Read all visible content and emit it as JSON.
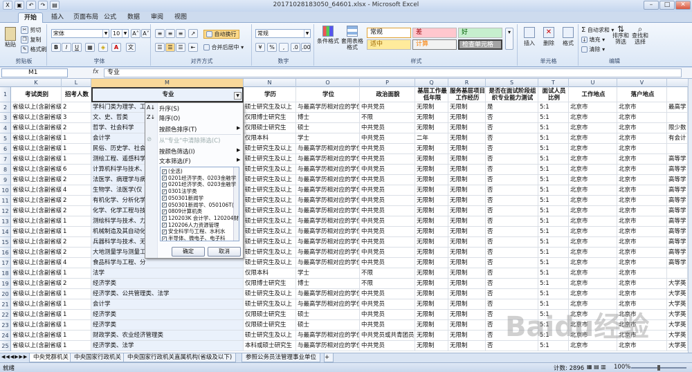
{
  "window": {
    "title": "20171028183050_64601.xlsx - Microsoft Excel"
  },
  "tabs": [
    "开始",
    "插入",
    "页面布局",
    "公式",
    "数据",
    "审阅",
    "视图"
  ],
  "ribbon": {
    "clipboard": {
      "label": "剪贴板",
      "paste": "粘贴",
      "cut": "剪切",
      "copy": "复制",
      "painter": "格式刷"
    },
    "font": {
      "label": "字体",
      "name": "宋体",
      "size": "10",
      "bold": "B",
      "italic": "I",
      "underline": "U"
    },
    "align": {
      "label": "对齐方式",
      "wrap": "自动换行",
      "merge": "合并后居中"
    },
    "number": {
      "label": "数字",
      "format": "常规",
      "percent": "%",
      "comma": ","
    },
    "styles": {
      "label": "样式",
      "cond": "条件格式",
      "table": "套用表格格式",
      "normal": "常规",
      "bad": "差",
      "good": "好",
      "neutral": "适中",
      "calc": "计算",
      "check": "检查单元格"
    },
    "cells": {
      "label": "单元格",
      "insert": "插入",
      "delete": "删除",
      "format": "格式"
    },
    "editing": {
      "label": "编辑",
      "autosum": "自动求和",
      "fill": "填充",
      "clear": "清除",
      "sort": "排序和筛选",
      "find": "查找和选择"
    }
  },
  "formula": {
    "cell": "M1",
    "fx": "fx",
    "value": "专业"
  },
  "columns": [
    "K",
    "L",
    "M",
    "N",
    "O",
    "P",
    "Q",
    "R",
    "S",
    "T",
    "U",
    "V"
  ],
  "headers": {
    "K": "考试类别",
    "L": "招考人数",
    "M": "专业",
    "N": "学历",
    "O": "学位",
    "P": "政治面貌",
    "Q": "基层工作最低年限",
    "R": "服务基层项目工作经历",
    "S": "是否在面试阶段组织专业能力测试",
    "T": "面试人员比例",
    "U": "工作地点",
    "V": "落户地点"
  },
  "rows": [
    {
      "n": "2",
      "K": "省级以上(含副省级)",
      "L": "2",
      "M": "学科门类为理学、工学",
      "N": "硕士研究生及以上",
      "O": "与最高学历相对应的学位",
      "P": "中共党员",
      "Q": "无限制",
      "R": "无限制",
      "S": "是",
      "T": "5:1",
      "U": "北京市",
      "V": "北京市",
      "W": "最高学"
    },
    {
      "n": "3",
      "K": "省级以上(含副省级)",
      "L": "3",
      "M": "文、史、哲类",
      "N": "仅限博士研究生",
      "O": "博士",
      "P": "不限",
      "Q": "无限制",
      "R": "无限制",
      "S": "否",
      "T": "5:1",
      "U": "北京市",
      "V": "北京市",
      "W": ""
    },
    {
      "n": "4",
      "K": "省级以上(含副省级)",
      "L": "2",
      "M": "哲学、社会科学",
      "N": "仅限硕士研究生",
      "O": "硕士",
      "P": "中共党员",
      "Q": "无限制",
      "R": "无限制",
      "S": "否",
      "T": "5:1",
      "U": "北京市",
      "V": "北京市",
      "W": "限少数"
    },
    {
      "n": "5",
      "K": "省级以上(含副省级)",
      "L": "1",
      "M": "会计学",
      "N": "仅限本科",
      "O": "学士",
      "P": "中共党员",
      "Q": "二年",
      "R": "无限制",
      "S": "否",
      "T": "5:1",
      "U": "北京市",
      "V": "北京市",
      "W": "有会计"
    },
    {
      "n": "6",
      "K": "省级以上(含副省级)",
      "L": "1",
      "M": "民俗、历史学、社会",
      "N": "硕士研究生及以上",
      "O": "与最高学历相对应的学位",
      "P": "中共党员",
      "Q": "无限制",
      "R": "无限制",
      "S": "否",
      "T": "5:1",
      "U": "北京市",
      "V": "北京市",
      "W": ""
    },
    {
      "n": "7",
      "K": "省级以上(含副省级)",
      "L": "1",
      "M": "测绘工程、遥感科学",
      "N": "硕士研究生及以上",
      "O": "与最高学历相对应的学位",
      "P": "中共党员",
      "Q": "无限制",
      "R": "无限制",
      "S": "否",
      "T": "5:1",
      "U": "北京市",
      "V": "北京市",
      "W": "高等学"
    },
    {
      "n": "8",
      "K": "省级以上(含副省级)",
      "L": "6",
      "M": "计算机科学与技术、",
      "N": "硕士研究生及以上",
      "O": "与最高学历相对应的学位",
      "P": "中共党员",
      "Q": "无限制",
      "R": "无限制",
      "S": "否",
      "T": "5:1",
      "U": "北京市",
      "V": "北京市",
      "W": "高等学"
    },
    {
      "n": "9",
      "K": "省级以上(含副省级)",
      "L": "2",
      "M": "法医学、病理学与病",
      "N": "硕士研究生及以上",
      "O": "与最高学历相对应的学位",
      "P": "中共党员",
      "Q": "无限制",
      "R": "无限制",
      "S": "否",
      "T": "5:1",
      "U": "北京市",
      "V": "北京市",
      "W": "高等学"
    },
    {
      "n": "10",
      "K": "省级以上(含副省级)",
      "L": "4",
      "M": "生物学、法医学(仅",
      "N": "硕士研究生及以上",
      "O": "与最高学历相对应的学位",
      "P": "中共党员",
      "Q": "无限制",
      "R": "无限制",
      "S": "否",
      "T": "5:1",
      "U": "北京市",
      "V": "北京市",
      "W": "高等学"
    },
    {
      "n": "11",
      "K": "省级以上(含副省级)",
      "L": "2",
      "M": "有机化学、分析化学",
      "N": "硕士研究生及以上",
      "O": "与最高学历相对应的学位",
      "P": "中共党员",
      "Q": "无限制",
      "R": "无限制",
      "S": "否",
      "T": "5:1",
      "U": "北京市",
      "V": "北京市",
      "W": "高等学"
    },
    {
      "n": "12",
      "K": "省级以上(含副省级)",
      "L": "2",
      "M": "化学、化学工程与技",
      "N": "硕士研究生及以上",
      "O": "与最高学历相对应的学位",
      "P": "中共党员",
      "Q": "无限制",
      "R": "无限制",
      "S": "否",
      "T": "5:1",
      "U": "北京市",
      "V": "北京市",
      "W": "高等学"
    },
    {
      "n": "13",
      "K": "省级以上(含副省级)",
      "L": "1",
      "M": "测绘科学与技术、力",
      "N": "硕士研究生及以上",
      "O": "与最高学历相对应的学位",
      "P": "中共党员",
      "Q": "无限制",
      "R": "无限制",
      "S": "否",
      "T": "5:1",
      "U": "北京市",
      "V": "北京市",
      "W": "高等学"
    },
    {
      "n": "14",
      "K": "省级以上(含副省级)",
      "L": "1",
      "M": "机械制造及其自动化",
      "N": "硕士研究生及以上",
      "O": "与最高学历相对应的学位",
      "P": "中共党员",
      "Q": "无限制",
      "R": "无限制",
      "S": "否",
      "T": "5:1",
      "U": "北京市",
      "V": "北京市",
      "W": "高等学"
    },
    {
      "n": "15",
      "K": "省级以上(含副省级)",
      "L": "2",
      "M": "兵器科学与技术、无",
      "N": "硕士研究生及以上",
      "O": "与最高学历相对应的学位",
      "P": "中共党员",
      "Q": "无限制",
      "R": "无限制",
      "S": "否",
      "T": "5:1",
      "U": "北京市",
      "V": "北京市",
      "W": "高等学"
    },
    {
      "n": "16",
      "K": "省级以上(含副省级)",
      "L": "2",
      "M": "大地测量学与测量工",
      "N": "硕士研究生及以上",
      "O": "与最高学历相对应的学位",
      "P": "中共党员",
      "Q": "无限制",
      "R": "无限制",
      "S": "否",
      "T": "5:1",
      "U": "北京市",
      "V": "北京市",
      "W": "高等学"
    },
    {
      "n": "17",
      "K": "省级以上(含副省级)",
      "L": "4",
      "M": "食品科学与工程、分",
      "N": "硕士研究生及以上",
      "O": "与最高学历相对应的学位",
      "P": "中共党员",
      "Q": "无限制",
      "R": "无限制",
      "S": "否",
      "T": "5:1",
      "U": "北京市",
      "V": "北京市",
      "W": "高等学"
    },
    {
      "n": "18",
      "K": "省级以上(含副省级)",
      "L": "1",
      "M": "法学",
      "N": "仅限本科",
      "O": "学士",
      "P": "不限",
      "Q": "无限制",
      "R": "无限制",
      "S": "否",
      "T": "5:1",
      "U": "北京市",
      "V": "北京市",
      "W": ""
    },
    {
      "n": "19",
      "K": "省级以上(含副省级)",
      "L": "2",
      "M": "经济学类",
      "N": "仅限博士研究生",
      "O": "博士",
      "P": "不限",
      "Q": "无限制",
      "R": "无限制",
      "S": "否",
      "T": "5:1",
      "U": "北京市",
      "V": "北京市",
      "W": "大学英"
    },
    {
      "n": "20",
      "K": "省级以上(含副省级)",
      "L": "1",
      "M": "经济学类、公共管理类、法学",
      "N": "硕士研究生及以上",
      "O": "与最高学历相对应的学位",
      "P": "中共党员",
      "Q": "无限制",
      "R": "无限制",
      "S": "否",
      "T": "5:1",
      "U": "北京市",
      "V": "北京市",
      "W": "大学英"
    },
    {
      "n": "21",
      "K": "省级以上(含副省级)",
      "L": "1",
      "M": "会计学",
      "N": "硕士研究生及以上",
      "O": "与最高学历相对应的学位",
      "P": "中共党员",
      "Q": "无限制",
      "R": "无限制",
      "S": "否",
      "T": "5:1",
      "U": "北京市",
      "V": "北京市",
      "W": "大学英"
    },
    {
      "n": "22",
      "K": "省级以上(含副省级)",
      "L": "1",
      "M": "经济学类",
      "N": "仅限硕士研究生",
      "O": "硕士",
      "P": "中共党员",
      "Q": "无限制",
      "R": "无限制",
      "S": "否",
      "T": "5:1",
      "U": "北京市",
      "V": "北京市",
      "W": "大学英"
    },
    {
      "n": "23",
      "K": "省级以上(含副省级)",
      "L": "1",
      "M": "经济学类",
      "N": "仅限硕士研究生",
      "O": "硕士",
      "P": "中共党员",
      "Q": "无限制",
      "R": "无限制",
      "S": "否",
      "T": "5:1",
      "U": "北京市",
      "V": "北京市",
      "W": "大学英"
    },
    {
      "n": "24",
      "K": "省级以上(含副省级)",
      "L": "1",
      "M": "财政学类、农业经济管理类",
      "N": "硕士研究生及以上",
      "O": "与最高学历相对应的学位",
      "P": "中共党员或共青团员",
      "Q": "无限制",
      "R": "无限制",
      "S": "否",
      "T": "5:1",
      "U": "北京市",
      "V": "北京市",
      "W": "大学英"
    },
    {
      "n": "25",
      "K": "省级以上(含副省级)",
      "L": "1",
      "M": "经济学类、法学",
      "N": "本科或硕士研究生",
      "O": "与最高学历相对应的学位",
      "P": "中共党员",
      "Q": "无限制",
      "R": "无限制",
      "S": "否",
      "T": "5:1",
      "U": "北京市",
      "V": "北京市",
      "W": "大学英"
    }
  ],
  "filter_menu": {
    "sort_asc": "升序(S)",
    "sort_desc": "降序(O)",
    "sort_color": "按颜色排序(T)",
    "clear": "从\"专业\"中清除筛选(C)",
    "filter_color": "按颜色筛选(I)",
    "text_filter": "文本筛选(F)",
    "list": [
      "(全选)",
      "0201经济学类、0203金融学",
      "0201经济学类、0203金融学",
      "0301法学类",
      "050301新闻学",
      "050301新闻学、050106T(",
      "0809计算机类",
      "120203K 会计学、120204财",
      "120206人力资源管理",
      "安全科学与工程、水利水",
      "半导体、微电子、电子科"
    ],
    "ok": "确定",
    "cancel": "取消"
  },
  "sheets": [
    "中央党群机关",
    "中央国家行政机关",
    "中央国家行政机关直属机构(省级及以下)",
    "参照公务员法管理事业单位"
  ],
  "status": {
    "ready": "就绪",
    "count": "计数: 2896",
    "zoom": "100%"
  },
  "watermark": "Baidu经验"
}
